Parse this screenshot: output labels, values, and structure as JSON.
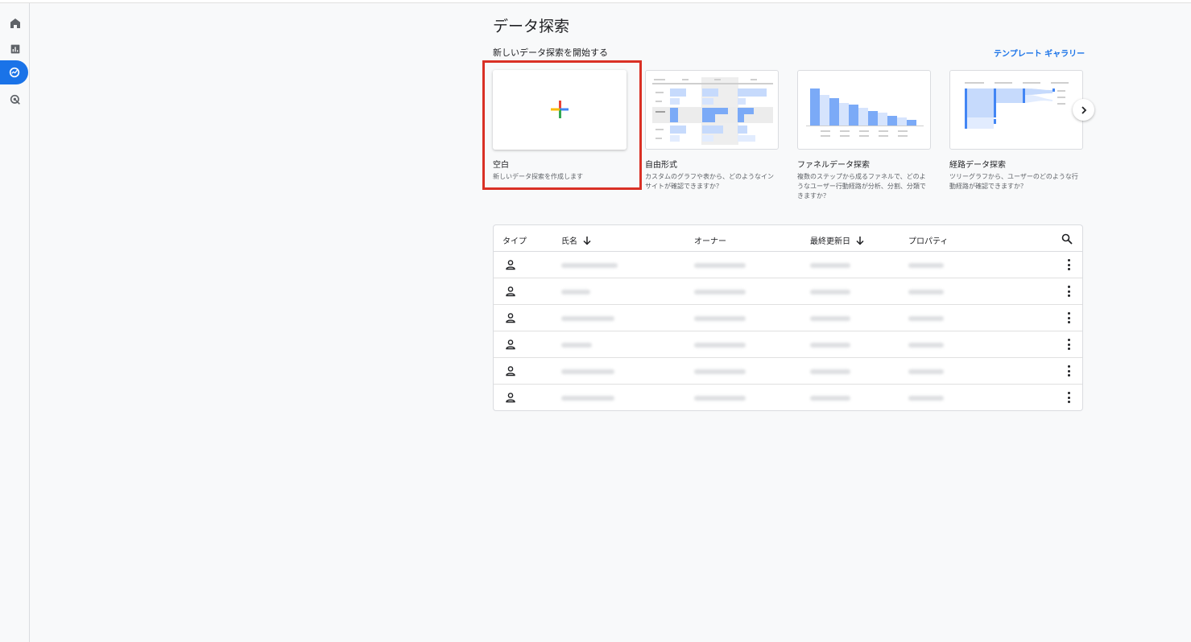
{
  "page": {
    "title": "データ探索",
    "section_label": "新しいデータ探索を開始する",
    "gallery_link": "テンプレート ギャラリー"
  },
  "nav": {
    "items": [
      {
        "icon": "home-icon"
      },
      {
        "icon": "reports-icon"
      },
      {
        "icon": "explore-icon",
        "active": true
      },
      {
        "icon": "advertising-icon"
      }
    ]
  },
  "templates": [
    {
      "title": "空白",
      "desc": "新しいデータ探索を作成します"
    },
    {
      "title": "自由形式",
      "desc": "カスタムのグラフや表から、どのようなインサイトが確認できますか？"
    },
    {
      "title": "ファネルデータ探索",
      "desc": "複数のステップから成るファネルで、どのようなユーザー行動経路が分析、分割、分類できますか？"
    },
    {
      "title": "経路データ探索",
      "desc": "ツリーグラフから、ユーザーのどのような行動経路が確認できますか？"
    }
  ],
  "table": {
    "headers": {
      "type": "タイプ",
      "name": "氏名",
      "owner": "オーナー",
      "modified": "最終更新日",
      "property": "プロパティ"
    },
    "row_count": 6
  },
  "colors": {
    "accent": "#1a73e8",
    "highlight": "#d93025"
  }
}
